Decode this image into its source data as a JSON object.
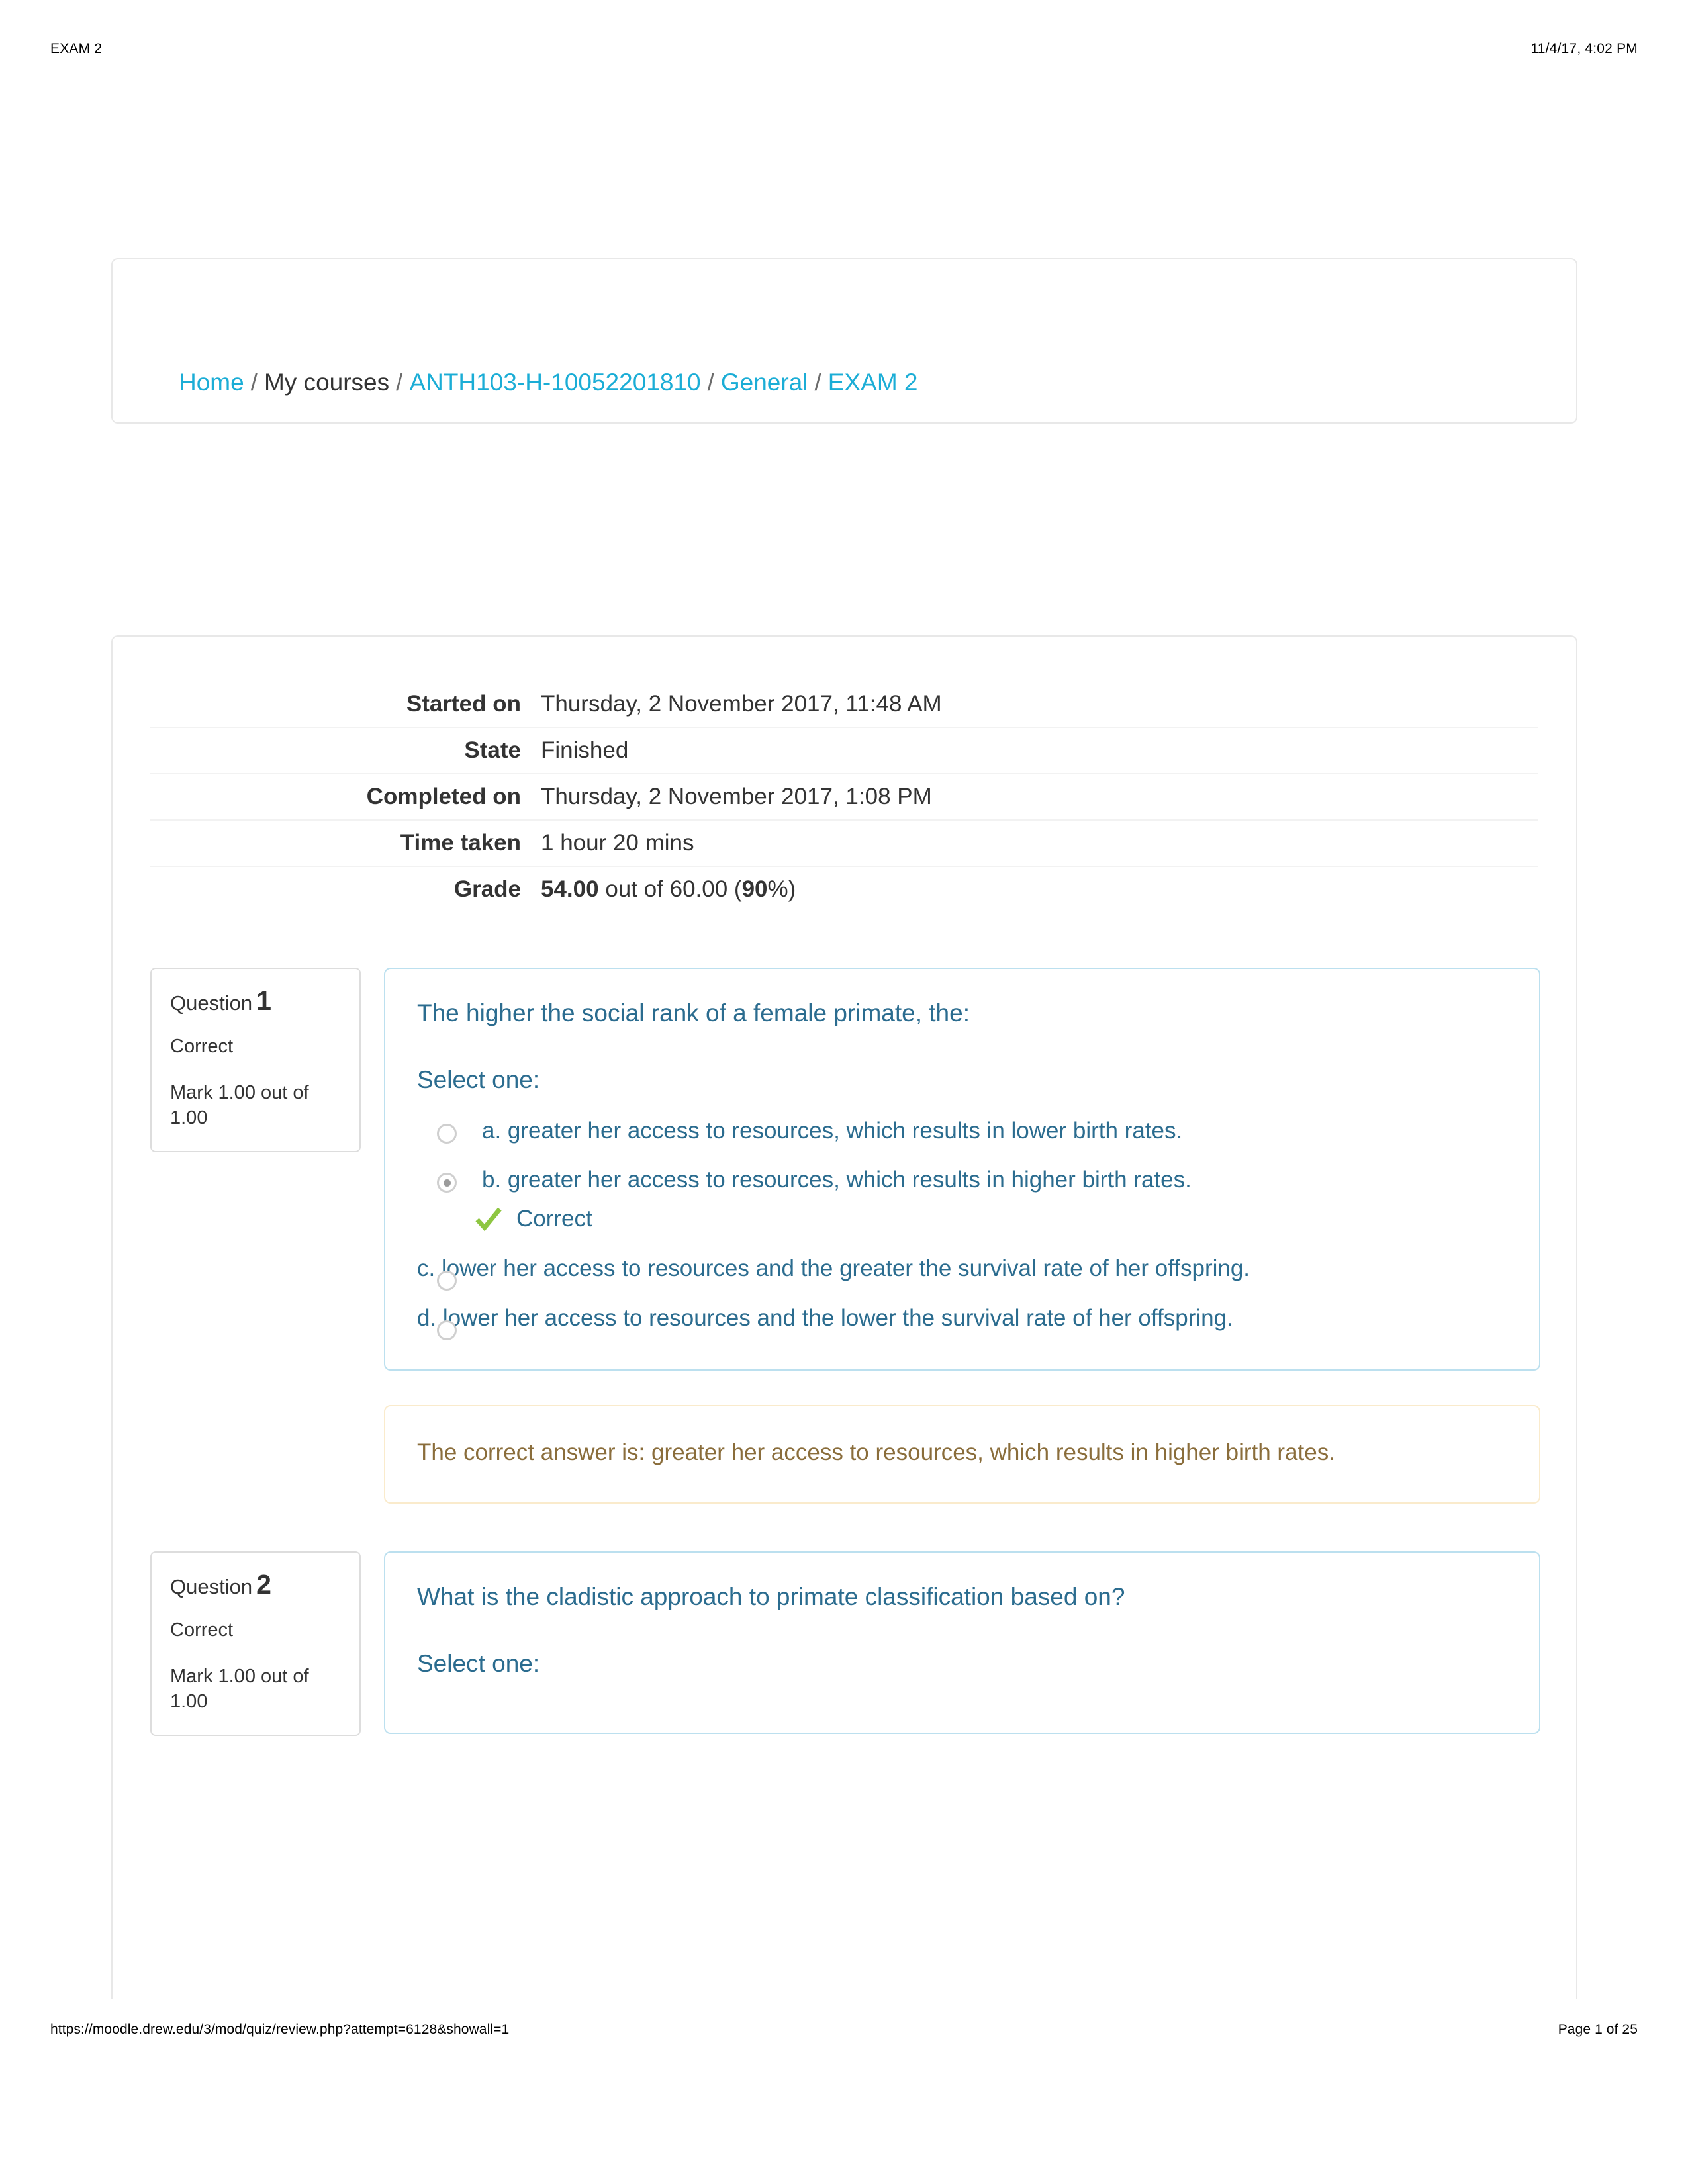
{
  "print": {
    "header_left": "EXAM 2",
    "header_right": "11/4/17, 4:02 PM",
    "footer_url": "https://moodle.drew.edu/3/mod/quiz/review.php?attempt=6128&showall=1",
    "footer_page": "Page 1 of 25"
  },
  "breadcrumb": {
    "items": [
      {
        "label": "Home",
        "link": true
      },
      {
        "label": "My courses",
        "link": false
      },
      {
        "label": "ANTH103-H-10052201810",
        "link": true
      },
      {
        "label": "General",
        "link": true
      },
      {
        "label": "EXAM 2",
        "link": true
      }
    ],
    "separator": "/"
  },
  "summary": {
    "rows": [
      {
        "label": "Started on",
        "value": "Thursday, 2 November 2017, 11:48 AM"
      },
      {
        "label": "State",
        "value": "Finished"
      },
      {
        "label": "Completed on",
        "value": "Thursday, 2 November 2017, 1:08 PM"
      },
      {
        "label": "Time taken",
        "value": "1 hour 20 mins"
      }
    ],
    "grade": {
      "label": "Grade",
      "score": "54.00",
      "mid": " out of 60.00 (",
      "percent": "90",
      "tail": "%)"
    }
  },
  "questions": [
    {
      "info": {
        "question_word": "Question",
        "number": "1",
        "state": "Correct",
        "mark": "Mark 1.00 out of 1.00"
      },
      "text": "The higher the social rank of a female primate, the:",
      "select_one": "Select one:",
      "answers": [
        {
          "letter_text": "a. greater her access to resources, which results in lower birth rates.",
          "selected": false,
          "feedback": ""
        },
        {
          "letter_text": "b. greater her access to resources, which results in higher birth rates.",
          "selected": true,
          "feedback": "Correct"
        },
        {
          "letter_text": "c. lower her access to resources and the greater the survival rate of her offspring.",
          "selected": false,
          "feedback": ""
        },
        {
          "letter_text": "d. lower her access to resources and the lower the survival rate of her offspring.",
          "selected": false,
          "feedback": ""
        }
      ],
      "correct_answer_feedback": "The correct answer is: greater her access to resources, which results in higher birth rates."
    },
    {
      "info": {
        "question_word": "Question",
        "number": "2",
        "state": "Correct",
        "mark": "Mark 1.00 out of 1.00"
      },
      "text": "What is the cladistic approach to primate classification based on?",
      "select_one": "Select one:"
    }
  ],
  "colors": {
    "link": "#1badd6",
    "question_text": "#2b6c8f",
    "feedback_text": "#8a6d3b",
    "feedback_border": "#faebcc",
    "question_border": "#bce0ef",
    "check_green": "#8ec641",
    "card_border": "#e8e8e8"
  }
}
